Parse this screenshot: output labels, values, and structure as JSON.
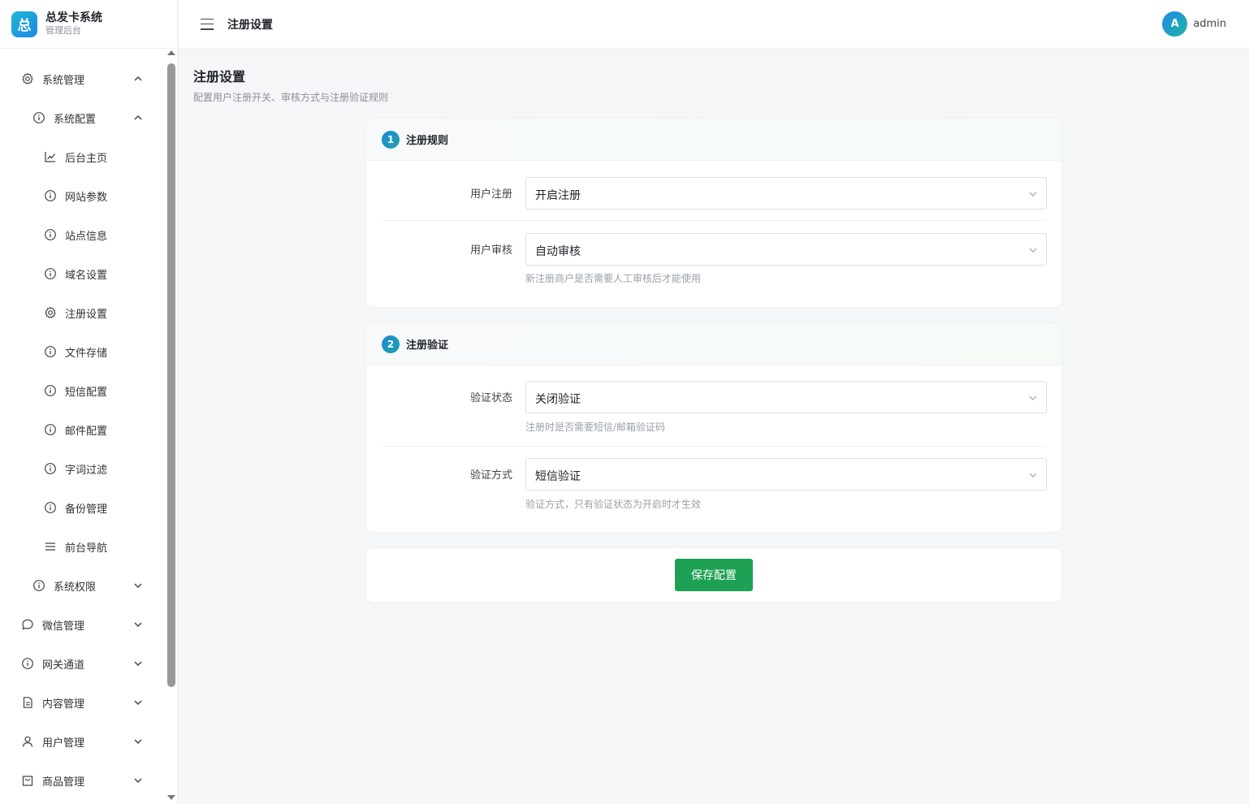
{
  "brand": {
    "logo_char": "总",
    "name": "总发卡系统",
    "subtitle": "管理后台"
  },
  "header": {
    "title": "注册设置",
    "avatar_letter": "A",
    "username": "admin"
  },
  "sidebar": {
    "items": [
      {
        "label": "系统管理",
        "level": 1,
        "icon": "gear-icon",
        "chevron": "up"
      },
      {
        "label": "系统配置",
        "level": 2,
        "icon": "info-circle-icon",
        "chevron": "up"
      },
      {
        "label": "后台主页",
        "level": 3,
        "icon": "line-chart-icon"
      },
      {
        "label": "网站参数",
        "level": 3,
        "icon": "info-circle-icon"
      },
      {
        "label": "站点信息",
        "level": 3,
        "icon": "info-circle-icon"
      },
      {
        "label": "域名设置",
        "level": 3,
        "icon": "info-circle-icon"
      },
      {
        "label": "注册设置",
        "level": 3,
        "icon": "gear-icon"
      },
      {
        "label": "文件存储",
        "level": 3,
        "icon": "info-circle-icon"
      },
      {
        "label": "短信配置",
        "level": 3,
        "icon": "info-circle-icon"
      },
      {
        "label": "邮件配置",
        "level": 3,
        "icon": "info-circle-icon"
      },
      {
        "label": "字词过滤",
        "level": 3,
        "icon": "info-circle-icon"
      },
      {
        "label": "备份管理",
        "level": 3,
        "icon": "info-circle-icon"
      },
      {
        "label": "前台导航",
        "level": 3,
        "icon": "menu-lines-icon"
      },
      {
        "label": "系统权限",
        "level": 2,
        "icon": "info-circle-icon",
        "chevron": "down"
      },
      {
        "label": "微信管理",
        "level": 1,
        "icon": "chat-bubble-icon",
        "chevron": "down"
      },
      {
        "label": "网关通道",
        "level": 1,
        "icon": "info-circle-icon",
        "chevron": "down"
      },
      {
        "label": "内容管理",
        "level": 1,
        "icon": "document-icon",
        "chevron": "down"
      },
      {
        "label": "用户管理",
        "level": 1,
        "icon": "user-icon",
        "chevron": "down"
      },
      {
        "label": "商品管理",
        "level": 1,
        "icon": "shopping-bag-icon",
        "chevron": "down"
      }
    ]
  },
  "page": {
    "title": "注册设置",
    "description": "配置用户注册开关、审核方式与注册验证规则"
  },
  "sections": [
    {
      "step": "1",
      "title": "注册规则",
      "fields": [
        {
          "label": "用户注册",
          "value": "开启注册",
          "hint": ""
        },
        {
          "label": "用户审核",
          "value": "自动审核",
          "hint": "新注册商户是否需要人工审核后才能使用"
        }
      ]
    },
    {
      "step": "2",
      "title": "注册验证",
      "fields": [
        {
          "label": "验证状态",
          "value": "关闭验证",
          "hint": "注册时是否需要短信/邮箱验证码"
        },
        {
          "label": "验证方式",
          "value": "短信验证",
          "hint": "验证方式，只有验证状态为开启时才生效"
        }
      ]
    }
  ],
  "save_button": "保存配置",
  "colors": {
    "primary_green": "#1ea154",
    "accent_blue": "#1a8ad6"
  }
}
